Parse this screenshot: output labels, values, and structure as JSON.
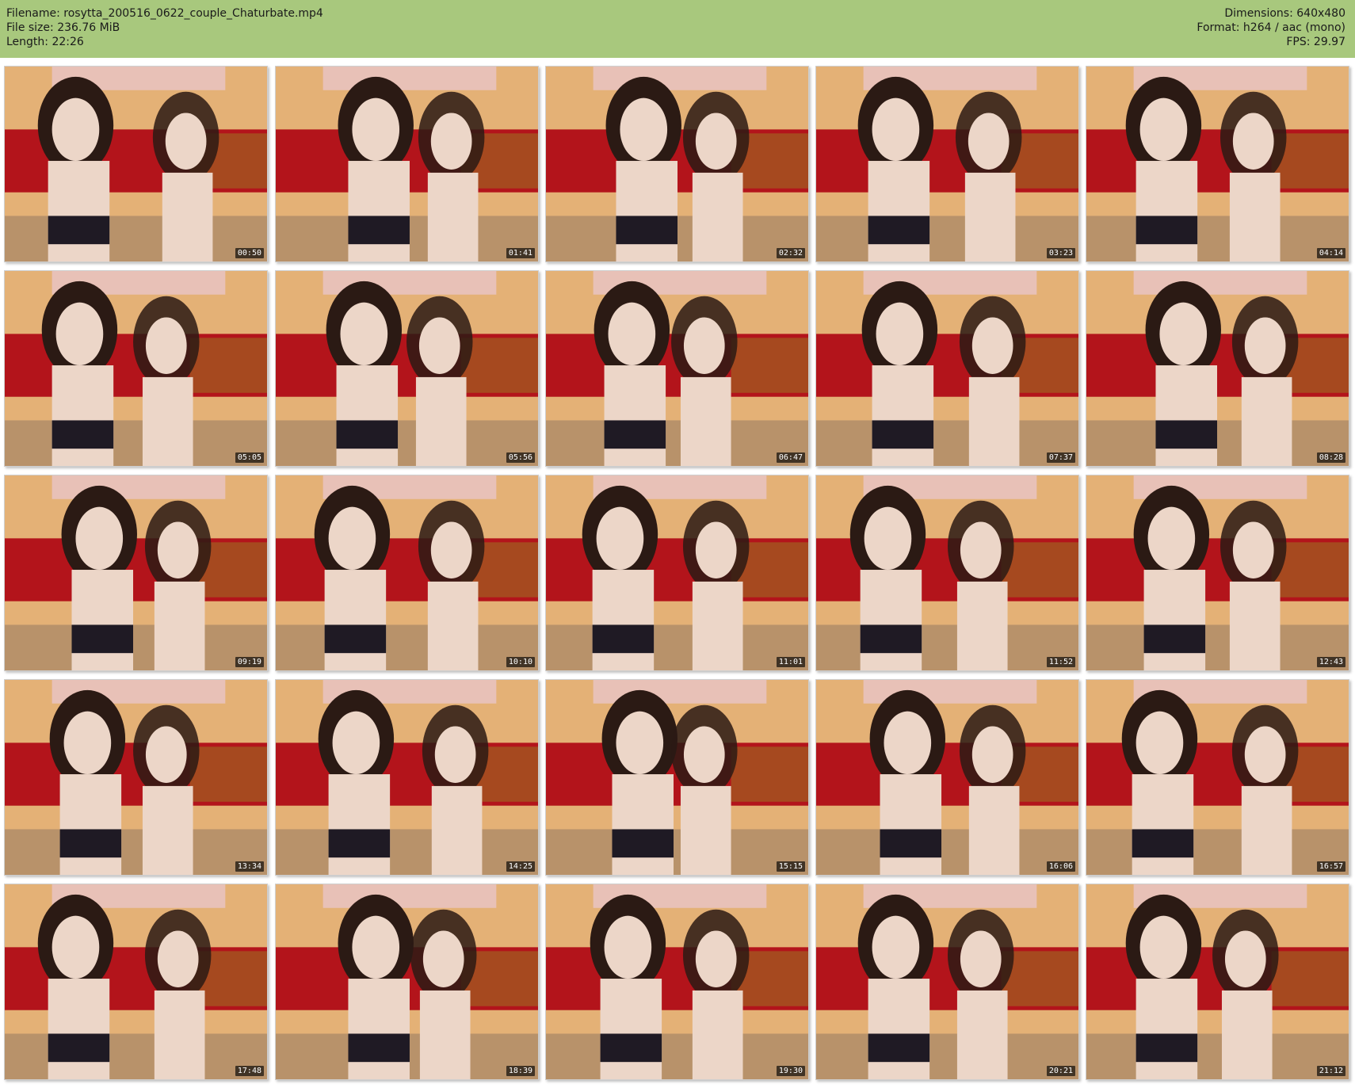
{
  "header": {
    "filename": "Filename: rosytta_200516_0622_couple_Chaturbate.mp4",
    "file_size": "File size: 236.76 MiB",
    "length": "Length: 22:26",
    "dimensions": "Dimensions: 640x480",
    "format": "Format: h264 / aac (mono)",
    "fps": "FPS: 29.97"
  },
  "colors": {
    "header_bg": "#a8c87d",
    "wall": "#e4b176",
    "sofa": "#b3141b",
    "floor": "#b8926a",
    "skin": "#ecd6c8",
    "hair": "#2b1a14",
    "bra": "#1f1a24"
  },
  "thumbnails": [
    {
      "time": "00:50"
    },
    {
      "time": "01:41"
    },
    {
      "time": "02:32"
    },
    {
      "time": "03:23"
    },
    {
      "time": "04:14"
    },
    {
      "time": "05:05"
    },
    {
      "time": "05:56"
    },
    {
      "time": "06:47"
    },
    {
      "time": "07:37"
    },
    {
      "time": "08:28"
    },
    {
      "time": "09:19"
    },
    {
      "time": "10:10"
    },
    {
      "time": "11:01"
    },
    {
      "time": "11:52"
    },
    {
      "time": "12:43"
    },
    {
      "time": "13:34"
    },
    {
      "time": "14:25"
    },
    {
      "time": "15:15"
    },
    {
      "time": "16:06"
    },
    {
      "time": "16:57"
    },
    {
      "time": "17:48"
    },
    {
      "time": "18:39"
    },
    {
      "time": "19:30"
    },
    {
      "time": "20:21"
    },
    {
      "time": "21:12"
    }
  ]
}
